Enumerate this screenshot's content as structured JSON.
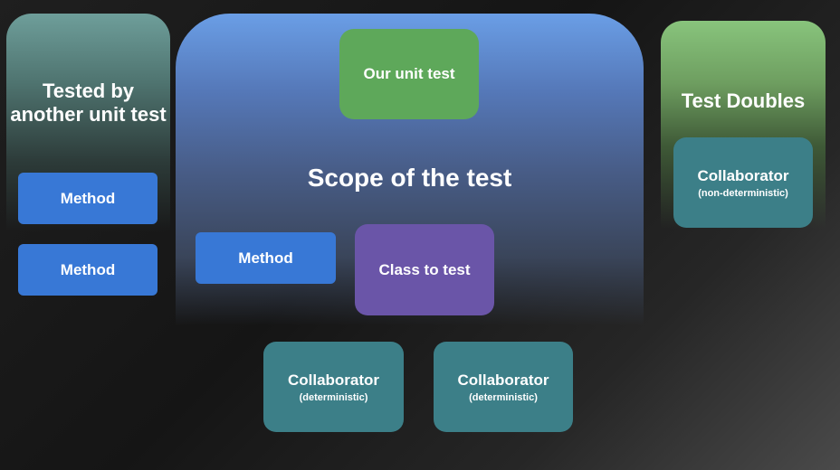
{
  "left_panel": {
    "heading": "Tested by another unit test",
    "methods": [
      "Method",
      "Method"
    ]
  },
  "center_panel": {
    "heading": "Scope of the test",
    "unit_test": "Our unit test",
    "method": "Method",
    "class_to_test": "Class to test"
  },
  "right_panel": {
    "heading": "Test Doubles",
    "collaborator": {
      "label": "Collaborator",
      "sub": "(non-deterministic)"
    }
  },
  "bottom": {
    "collaborators": [
      {
        "label": "Collaborator",
        "sub": "(deterministic)"
      },
      {
        "label": "Collaborator",
        "sub": "(deterministic)"
      }
    ]
  },
  "colors": {
    "method": "#3878d6",
    "unit_test": "#5ea85a",
    "class_to_test": "#6a55a8",
    "collaborator": "#3c7f88"
  }
}
